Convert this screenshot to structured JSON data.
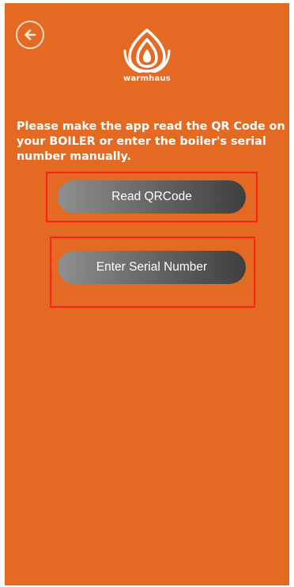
{
  "header": {
    "back_icon": "arrow-left-icon",
    "brand_name": "warmhaus",
    "logo_icon": "flame-logo-icon"
  },
  "instruction": "Please make the app read the QR Code on your BOILER or enter the boiler's serial number manually.",
  "buttons": {
    "read_qr": "Read QRCode",
    "enter_serial": "Enter Serial Number"
  },
  "colors": {
    "background": "#e46a24",
    "highlight": "#ff1f1f",
    "button_start": "#8f8f8f",
    "button_end": "#3f3f3f"
  }
}
